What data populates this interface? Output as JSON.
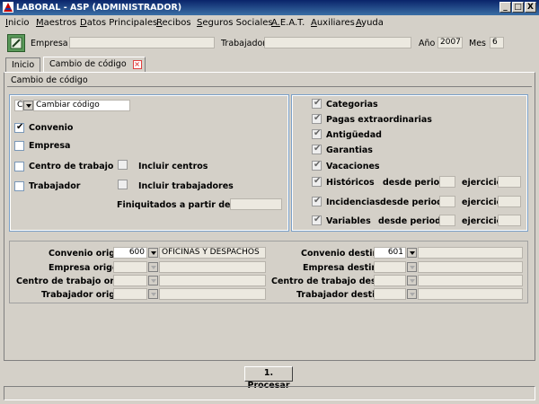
{
  "window": {
    "title": "LABORAL - ASP (ADMINISTRADOR)",
    "controls": [
      "_",
      "□",
      "X"
    ]
  },
  "menu": [
    "Inicio",
    "Maestros",
    "Datos Principales",
    "Recibos",
    "Seguros Sociales",
    "A.E.A.T.",
    "Auxiliares",
    "Ayuda"
  ],
  "header": {
    "empresa_label": "Empresa",
    "trabajador_label": "Trabajador",
    "anio_label": "Año",
    "anio_value": "2007",
    "mes_label": "Mes",
    "mes_value": "6"
  },
  "tabs": [
    {
      "label": "Inicio"
    },
    {
      "label": "Cambio de código"
    }
  ],
  "section_title": "Cambio de código",
  "left": {
    "combo_code": "C",
    "combo_text": "Cambiar código",
    "options": [
      {
        "label": "Convenio",
        "checked": true
      },
      {
        "label": "Empresa",
        "checked": false
      },
      {
        "label": "Centro de trabajo",
        "checked": false
      },
      {
        "label": "Trabajador",
        "checked": false
      }
    ],
    "incluir_centros": "Incluir centros",
    "incluir_trabajadores": "Incluir trabajadores",
    "finiquitados_label": "Finiquitados a partir de"
  },
  "right": {
    "items": [
      {
        "label": "Categorias",
        "checked": true
      },
      {
        "label": "Pagas extraordinarias",
        "checked": true
      },
      {
        "label": "Antigüedad",
        "checked": true
      },
      {
        "label": "Garantias",
        "checked": true
      },
      {
        "label": "Vacaciones",
        "checked": true
      },
      {
        "label": "Históricos",
        "checked": true
      },
      {
        "label": "Incidencias",
        "checked": true
      },
      {
        "label": "Variables",
        "checked": true
      }
    ],
    "desde_periodo": "desde periodo",
    "ejercicio": "ejercicio"
  },
  "bottom": {
    "convenio_origen_label": "Convenio origen",
    "convenio_origen_code": "600",
    "convenio_origen_name": "OFICINAS Y DESPACHOS",
    "convenio_destino_label": "Convenio destino",
    "convenio_destino_code": "601",
    "empresa_origen_label": "Empresa origen",
    "empresa_destino_label": "Empresa destino",
    "centro_origen_label": "Centro de trabajo origen",
    "centro_destino_label": "Centro de trabajo destino",
    "trabajador_origen_label": "Trabajador origen",
    "trabajador_destino_label": "Trabajador destino"
  },
  "procesar_button": "1. Procesar",
  "colors": {
    "titlebar": "#0a246a",
    "tab_close": "#e04040"
  }
}
